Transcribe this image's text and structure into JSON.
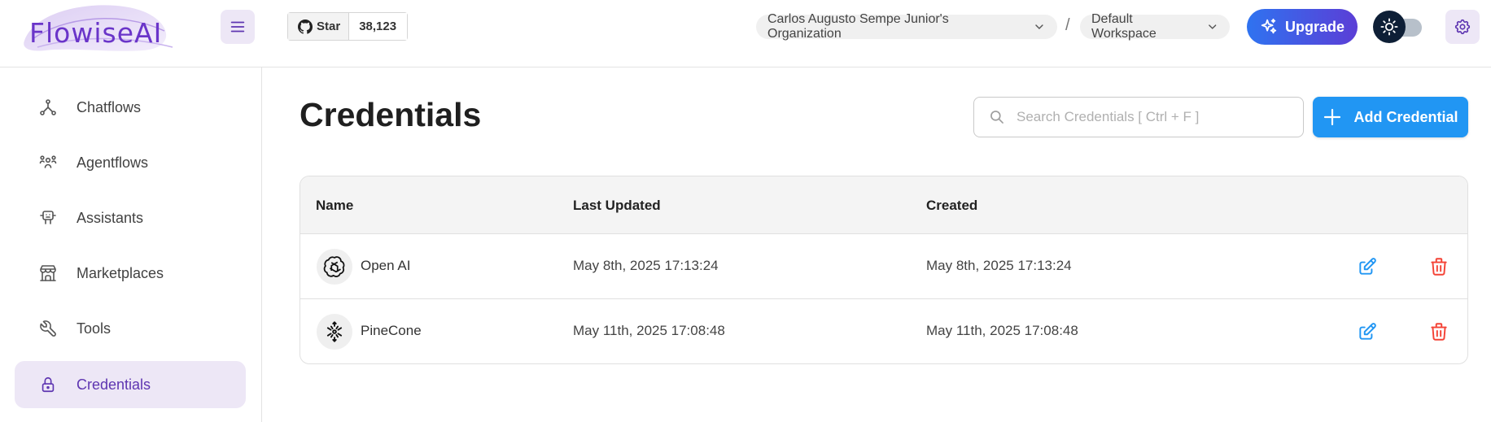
{
  "header": {
    "logo_text": "FlowiseAI",
    "github": {
      "star_label": "Star",
      "star_count": "38,123"
    },
    "organization": "Carlos Augusto Sempe Junior's Organization",
    "separator": "/",
    "workspace": "Default Workspace",
    "upgrade_label": "Upgrade"
  },
  "sidebar": {
    "items": [
      {
        "label": "Chatflows",
        "icon": "hierarchy-icon"
      },
      {
        "label": "Agentflows",
        "icon": "users-group-icon"
      },
      {
        "label": "Assistants",
        "icon": "robot-icon"
      },
      {
        "label": "Marketplaces",
        "icon": "building-store-icon"
      },
      {
        "label": "Tools",
        "icon": "tool-icon"
      },
      {
        "label": "Credentials",
        "icon": "lock-icon",
        "active": true
      }
    ]
  },
  "main": {
    "title": "Credentials",
    "search_placeholder": "Search Credentials [ Ctrl + F ]",
    "add_label": "Add Credential",
    "table": {
      "columns": [
        "Name",
        "Last Updated",
        "Created"
      ],
      "rows": [
        {
          "name": "Open AI",
          "icon": "openai-icon",
          "last_updated": "May 8th, 2025 17:13:24",
          "created": "May 8th, 2025 17:13:24"
        },
        {
          "name": "PineCone",
          "icon": "pinecone-icon",
          "last_updated": "May 11th, 2025 17:08:48",
          "created": "May 11th, 2025 17:08:48"
        }
      ]
    }
  },
  "colors": {
    "brand_purple": "#5e35b1",
    "primary_blue": "#2196f3",
    "delete_red": "#f44336",
    "active_bg": "#ede7f6"
  }
}
